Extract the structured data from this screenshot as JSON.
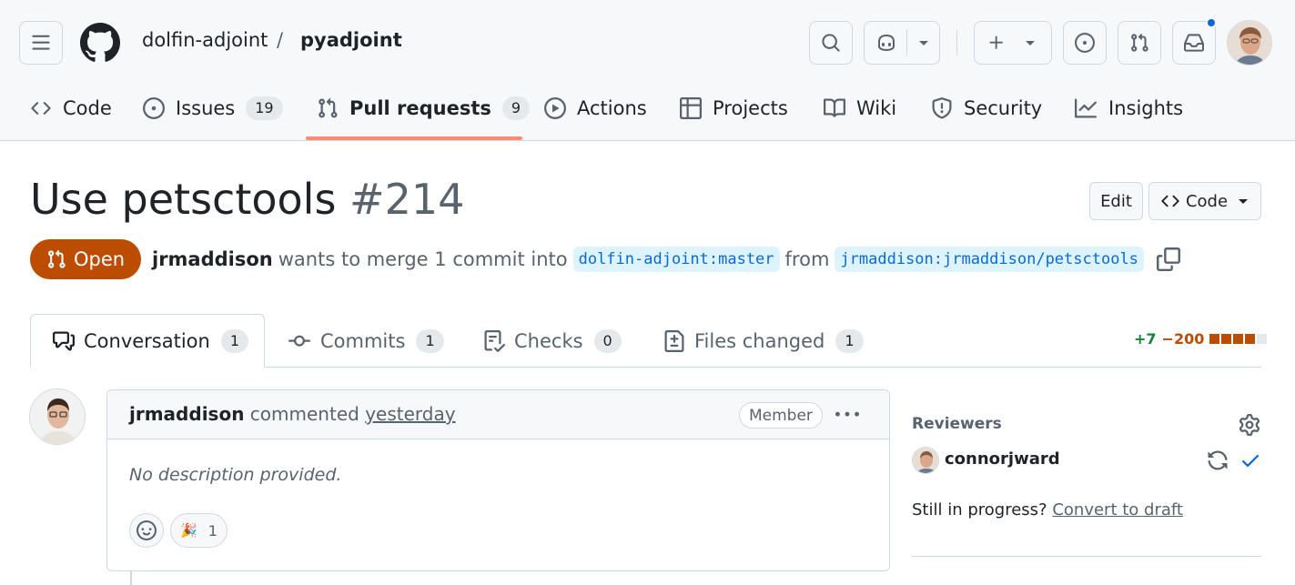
{
  "header": {
    "repo_owner": "dolfin-adjoint",
    "separator": "/",
    "repo_name": "pyadjoint"
  },
  "nav": {
    "code": "Code",
    "issues": "Issues",
    "issues_count": "19",
    "pulls": "Pull requests",
    "pulls_count": "9",
    "actions": "Actions",
    "projects": "Projects",
    "wiki": "Wiki",
    "security": "Security",
    "insights": "Insights"
  },
  "pr": {
    "title": "Use petsctools",
    "number": "#214",
    "edit_label": "Edit",
    "code_label": "Code",
    "state": "Open",
    "author": "jrmaddison",
    "merge_text": "wants to merge 1 commit into",
    "base_branch": "dolfin-adjoint:master",
    "from_text": "from",
    "head_branch": "jrmaddison:jrmaddison/petsctools"
  },
  "tabs": [
    {
      "label": "Conversation",
      "count": "1"
    },
    {
      "label": "Commits",
      "count": "1"
    },
    {
      "label": "Checks",
      "count": "0"
    },
    {
      "label": "Files changed",
      "count": "1"
    }
  ],
  "diffstat": {
    "additions": "+7",
    "deletions": "−200"
  },
  "comment": {
    "author": "jrmaddison",
    "action": "commented",
    "time": "yesterday",
    "role": "Member",
    "body": "No description provided.",
    "reaction_emoji": "🎉",
    "reaction_count": "1"
  },
  "sidebar": {
    "reviewers_heading": "Reviewers",
    "reviewer_name": "connorjward",
    "draft_prompt": "Still in progress?",
    "draft_link": "Convert to draft"
  },
  "colors": {
    "accent": "#0969da",
    "open_state": "#bc4c00",
    "nav_underline": "#fd8c73",
    "additions": "#1a7f37",
    "deletions": "#bc4c00"
  }
}
